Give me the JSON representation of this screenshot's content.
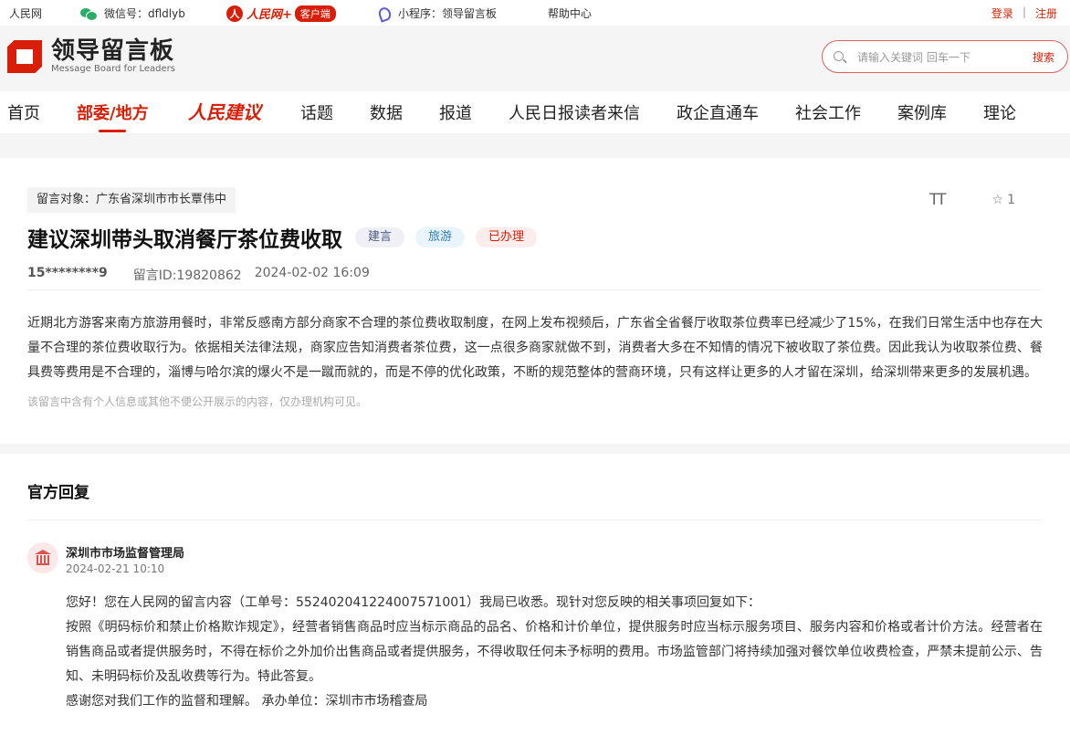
{
  "topbar": {
    "site": "人民网",
    "wechat": "微信号：dfldlyb",
    "rmw_circle": "人",
    "rmw_name": "人民网+",
    "rmw_badge": "客户端",
    "miniprogram": "小程序：领导留言板",
    "help": "帮助中心",
    "login": "登录",
    "separator": "|",
    "register": "注册"
  },
  "header": {
    "logo_title": "领导留言板",
    "logo_subtitle": "Message Board for Leaders",
    "search_placeholder": "请输入关键词 回车一下",
    "search_button": "搜索"
  },
  "nav": {
    "items": [
      "首页",
      "部委/地方",
      "人民建议",
      "话题",
      "数据",
      "报道",
      "人民日报读者来信",
      "政企直通车",
      "社会工作",
      "案例库",
      "理论"
    ],
    "active": "部委/地方"
  },
  "message": {
    "target": "留言对象：广东省深圳市市长覃伟中",
    "font_tool": "TT",
    "favorite_count": "1",
    "title": "建议深圳带头取消餐厅茶位费收取",
    "tags": [
      "建言",
      "旅游",
      "已办理"
    ],
    "user": "15********9",
    "message_id": "留言ID:19820862",
    "datetime": "2024-02-02 16:09",
    "content": "近期北方游客来南方旅游用餐时，非常反感南方部分商家不合理的茶位费收取制度，在网上发布视频后，广东省全省餐厅收取茶位费率已经减少了15%，在我们日常生活中也存在大量不合理的茶位费收取行为。依据相关法律法规，商家应告知消费者茶位费，这一点很多商家就做不到，消费者大多在不知情的情况下被收取了茶位费。因此我认为收取茶位费、餐具费等费用是不合理的，淄博与哈尔滨的爆火不是一蹴而就的，而是不停的优化政策，不断的规范整体的营商环境，只有这样让更多的人才留在深圳，给深圳带来更多的发展机遇。",
    "privacy_notice": "该留言中含有个人信息或其他不便公开展示的内容，仅办理机构可见。"
  },
  "reply": {
    "section_title": "官方回复",
    "org_name": "深圳市市场监督管理局",
    "datetime": "2024-02-21 10:10",
    "lines": [
      "您好！您在人民网的留言内容（工单号：552402041224007571001）我局已收悉。现针对您反映的相关事项回复如下：",
      "按照《明码标价和禁止价格欺诈规定》，经营者销售商品时应当标示商品的品名、价格和计价单位，提供服务时应当标示服务项目、服务内容和价格或者计价方法。经营者在销售商品或者提供服务时，不得在标价之外加价出售商品或者提供服务，不得收取任何未予标明的费用。市场监管部门将持续加强对餐饮单位收费检查，严禁未提前公示、告知、未明码标价及乱收费等行为。特此答复。",
      "感谢您对我们工作的监督和理解。 承办单位：深圳市市场稽查局"
    ]
  }
}
